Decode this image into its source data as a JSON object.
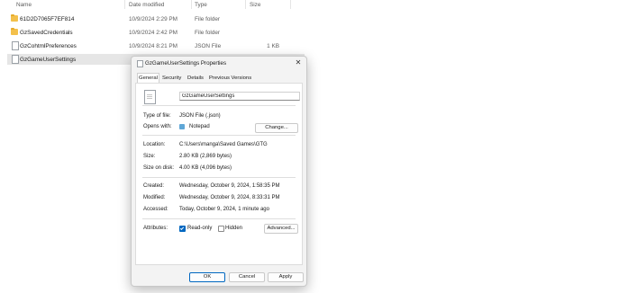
{
  "explorer": {
    "columns": {
      "name": "Name",
      "date": "Date modified",
      "type": "Type",
      "size": "Size"
    },
    "rows": [
      {
        "name": "61D2D7065F7EF814",
        "date": "10/9/2024 2:29 PM",
        "type": "File folder",
        "size": "",
        "icon": "folder-icon"
      },
      {
        "name": "GzSavedCredentials",
        "date": "10/9/2024 2:42 PM",
        "type": "File folder",
        "size": "",
        "icon": "folder-icon"
      },
      {
        "name": "GzCohtmlPreferences",
        "date": "10/9/2024 8:21 PM",
        "type": "JSON File",
        "size": "1 KB",
        "icon": "json-file-icon"
      },
      {
        "name": "GzGameUserSettings",
        "date": "",
        "type": "",
        "size": "",
        "icon": "json-file-icon",
        "selected": true
      }
    ]
  },
  "dialog": {
    "title": "GzGameUserSettings Properties",
    "close_glyph": "✕",
    "tabs": [
      "General",
      "Security",
      "Details",
      "Previous Versions"
    ],
    "active_tab": "General",
    "file_name": "GzGameUserSettings",
    "type_label": "Type of file:",
    "type_value": "JSON File (.json)",
    "opens_label": "Opens with:",
    "opens_value": "Notepad",
    "change_button": "Change...",
    "location_label": "Location:",
    "location_value": "C:\\Users\\manga\\Saved Games\\GTG",
    "size_label": "Size:",
    "size_value": "2.80 KB (2,869 bytes)",
    "size_disk_label": "Size on disk:",
    "size_disk_value": "4.00 KB (4,096 bytes)",
    "created_label": "Created:",
    "created_value": "Wednesday, October 9, 2024, 1:58:35 PM",
    "modified_label": "Modified:",
    "modified_value": "Wednesday, October 9, 2024, 8:33:31 PM",
    "accessed_label": "Accessed:",
    "accessed_value": "Today, October 9, 2024, 1 minute ago",
    "attributes_label": "Attributes:",
    "readonly_label": "Read-only",
    "readonly_checked": true,
    "hidden_label": "Hidden",
    "hidden_checked": false,
    "advanced_button": "Advanced...",
    "ok_button": "OK",
    "cancel_button": "Cancel",
    "apply_button": "Apply"
  },
  "colors": {
    "accent": "#0067c0",
    "folder": "#f3c04b",
    "selected_row": "#e6e6e6"
  }
}
